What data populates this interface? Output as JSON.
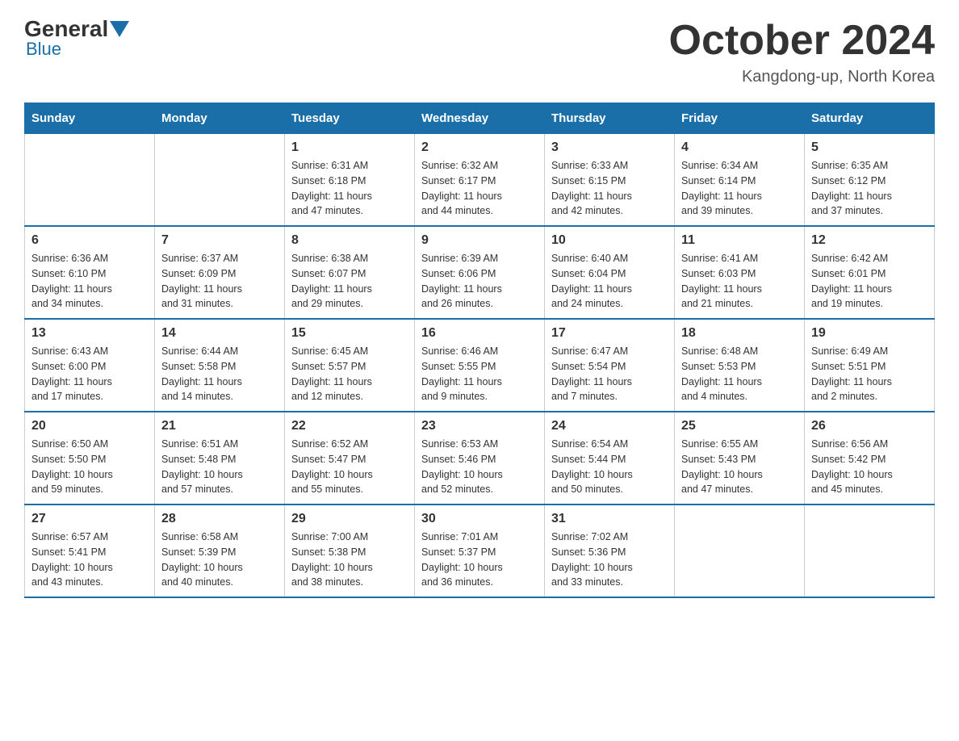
{
  "header": {
    "logo_general": "General",
    "logo_blue": "Blue",
    "month_title": "October 2024",
    "location": "Kangdong-up, North Korea"
  },
  "days_of_week": [
    "Sunday",
    "Monday",
    "Tuesday",
    "Wednesday",
    "Thursday",
    "Friday",
    "Saturday"
  ],
  "weeks": [
    [
      {
        "day": "",
        "info": ""
      },
      {
        "day": "",
        "info": ""
      },
      {
        "day": "1",
        "info": "Sunrise: 6:31 AM\nSunset: 6:18 PM\nDaylight: 11 hours\nand 47 minutes."
      },
      {
        "day": "2",
        "info": "Sunrise: 6:32 AM\nSunset: 6:17 PM\nDaylight: 11 hours\nand 44 minutes."
      },
      {
        "day": "3",
        "info": "Sunrise: 6:33 AM\nSunset: 6:15 PM\nDaylight: 11 hours\nand 42 minutes."
      },
      {
        "day": "4",
        "info": "Sunrise: 6:34 AM\nSunset: 6:14 PM\nDaylight: 11 hours\nand 39 minutes."
      },
      {
        "day": "5",
        "info": "Sunrise: 6:35 AM\nSunset: 6:12 PM\nDaylight: 11 hours\nand 37 minutes."
      }
    ],
    [
      {
        "day": "6",
        "info": "Sunrise: 6:36 AM\nSunset: 6:10 PM\nDaylight: 11 hours\nand 34 minutes."
      },
      {
        "day": "7",
        "info": "Sunrise: 6:37 AM\nSunset: 6:09 PM\nDaylight: 11 hours\nand 31 minutes."
      },
      {
        "day": "8",
        "info": "Sunrise: 6:38 AM\nSunset: 6:07 PM\nDaylight: 11 hours\nand 29 minutes."
      },
      {
        "day": "9",
        "info": "Sunrise: 6:39 AM\nSunset: 6:06 PM\nDaylight: 11 hours\nand 26 minutes."
      },
      {
        "day": "10",
        "info": "Sunrise: 6:40 AM\nSunset: 6:04 PM\nDaylight: 11 hours\nand 24 minutes."
      },
      {
        "day": "11",
        "info": "Sunrise: 6:41 AM\nSunset: 6:03 PM\nDaylight: 11 hours\nand 21 minutes."
      },
      {
        "day": "12",
        "info": "Sunrise: 6:42 AM\nSunset: 6:01 PM\nDaylight: 11 hours\nand 19 minutes."
      }
    ],
    [
      {
        "day": "13",
        "info": "Sunrise: 6:43 AM\nSunset: 6:00 PM\nDaylight: 11 hours\nand 17 minutes."
      },
      {
        "day": "14",
        "info": "Sunrise: 6:44 AM\nSunset: 5:58 PM\nDaylight: 11 hours\nand 14 minutes."
      },
      {
        "day": "15",
        "info": "Sunrise: 6:45 AM\nSunset: 5:57 PM\nDaylight: 11 hours\nand 12 minutes."
      },
      {
        "day": "16",
        "info": "Sunrise: 6:46 AM\nSunset: 5:55 PM\nDaylight: 11 hours\nand 9 minutes."
      },
      {
        "day": "17",
        "info": "Sunrise: 6:47 AM\nSunset: 5:54 PM\nDaylight: 11 hours\nand 7 minutes."
      },
      {
        "day": "18",
        "info": "Sunrise: 6:48 AM\nSunset: 5:53 PM\nDaylight: 11 hours\nand 4 minutes."
      },
      {
        "day": "19",
        "info": "Sunrise: 6:49 AM\nSunset: 5:51 PM\nDaylight: 11 hours\nand 2 minutes."
      }
    ],
    [
      {
        "day": "20",
        "info": "Sunrise: 6:50 AM\nSunset: 5:50 PM\nDaylight: 10 hours\nand 59 minutes."
      },
      {
        "day": "21",
        "info": "Sunrise: 6:51 AM\nSunset: 5:48 PM\nDaylight: 10 hours\nand 57 minutes."
      },
      {
        "day": "22",
        "info": "Sunrise: 6:52 AM\nSunset: 5:47 PM\nDaylight: 10 hours\nand 55 minutes."
      },
      {
        "day": "23",
        "info": "Sunrise: 6:53 AM\nSunset: 5:46 PM\nDaylight: 10 hours\nand 52 minutes."
      },
      {
        "day": "24",
        "info": "Sunrise: 6:54 AM\nSunset: 5:44 PM\nDaylight: 10 hours\nand 50 minutes."
      },
      {
        "day": "25",
        "info": "Sunrise: 6:55 AM\nSunset: 5:43 PM\nDaylight: 10 hours\nand 47 minutes."
      },
      {
        "day": "26",
        "info": "Sunrise: 6:56 AM\nSunset: 5:42 PM\nDaylight: 10 hours\nand 45 minutes."
      }
    ],
    [
      {
        "day": "27",
        "info": "Sunrise: 6:57 AM\nSunset: 5:41 PM\nDaylight: 10 hours\nand 43 minutes."
      },
      {
        "day": "28",
        "info": "Sunrise: 6:58 AM\nSunset: 5:39 PM\nDaylight: 10 hours\nand 40 minutes."
      },
      {
        "day": "29",
        "info": "Sunrise: 7:00 AM\nSunset: 5:38 PM\nDaylight: 10 hours\nand 38 minutes."
      },
      {
        "day": "30",
        "info": "Sunrise: 7:01 AM\nSunset: 5:37 PM\nDaylight: 10 hours\nand 36 minutes."
      },
      {
        "day": "31",
        "info": "Sunrise: 7:02 AM\nSunset: 5:36 PM\nDaylight: 10 hours\nand 33 minutes."
      },
      {
        "day": "",
        "info": ""
      },
      {
        "day": "",
        "info": ""
      }
    ]
  ]
}
